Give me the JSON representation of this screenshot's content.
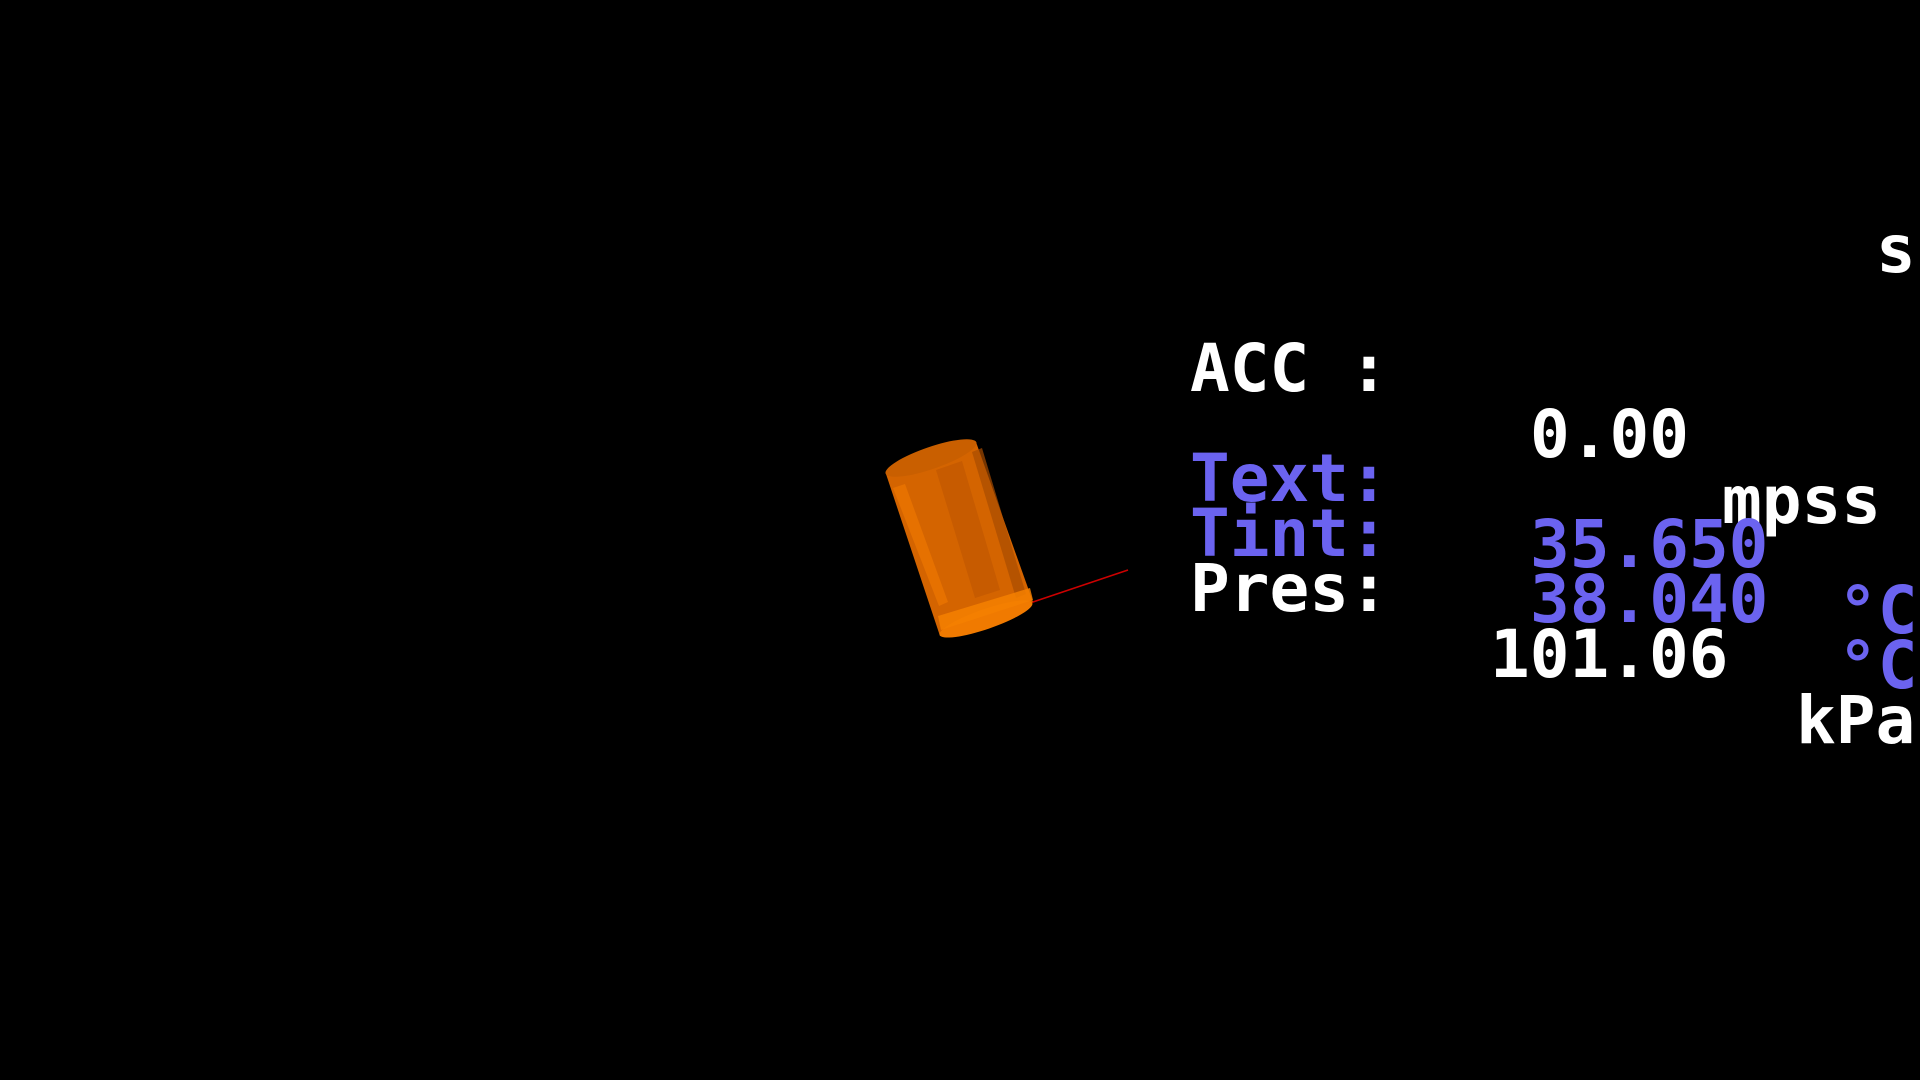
{
  "viewport": {
    "background_color": "#000000",
    "object": {
      "name": "cylinder-model",
      "color": "#e06a00",
      "shade_color": "#b85500"
    },
    "axis_line": {
      "color": "#cc0000"
    }
  },
  "hud": {
    "partial_unit": "s",
    "acc": {
      "label": "ACC :",
      "value": "0.00",
      "unit": "mpss"
    },
    "text": {
      "label": "Text:",
      "value": "35.650",
      "unit": "°C"
    },
    "tint": {
      "label": "Tint:",
      "value": "38.040",
      "unit": "°C"
    },
    "pres": {
      "label": "Pres:",
      "value": "101.06",
      "unit": "kPa"
    },
    "colors": {
      "primary": "#ffffff",
      "temperature": "#6b63f0"
    }
  }
}
